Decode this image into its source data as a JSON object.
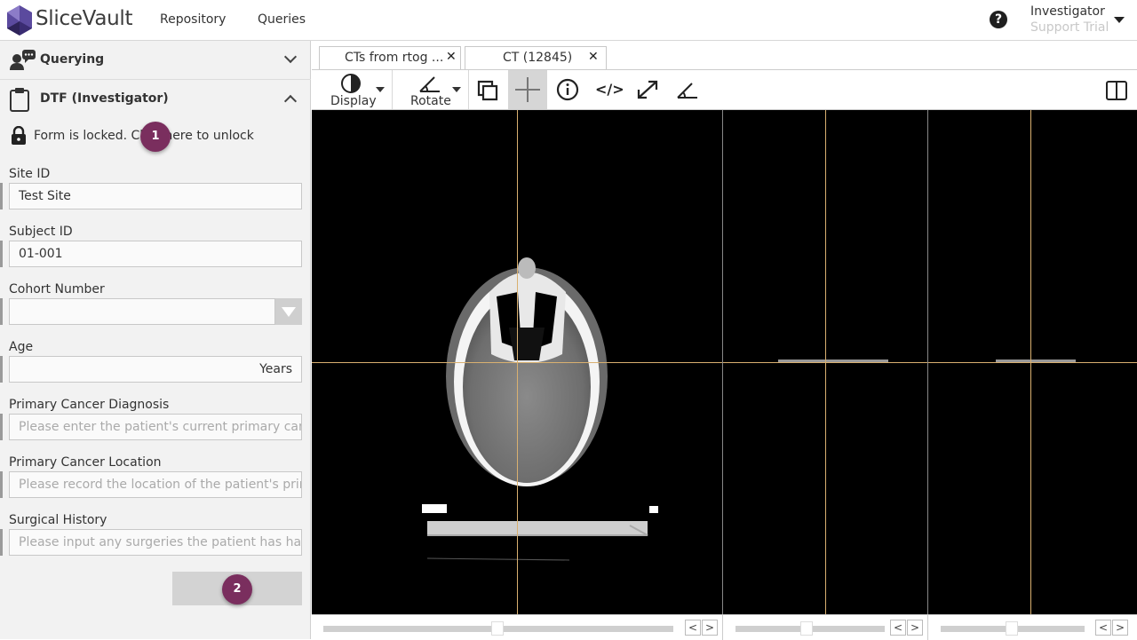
{
  "app": {
    "brand": "SliceVault",
    "brand_color": "#4a3a8c"
  },
  "nav": {
    "items": [
      "Repository",
      "Queries"
    ]
  },
  "user": {
    "name": "Investigator",
    "role": "Support Trial"
  },
  "sidebar": {
    "querying_title": "Querying",
    "form_title": "DTF (Investigator)",
    "lock_message": "Form is locked. Click here to unlock",
    "fields": {
      "site_id": {
        "label": "Site ID",
        "value": "Test Site"
      },
      "subject_id": {
        "label": "Subject ID",
        "value": "01-001"
      },
      "cohort": {
        "label": "Cohort Number",
        "value": ""
      },
      "age": {
        "label": "Age",
        "unit": "Years"
      },
      "diagnosis": {
        "label": "Primary Cancer Diagnosis",
        "placeholder": "Please enter the patient's current primary cancer"
      },
      "location": {
        "label": "Primary Cancer Location",
        "placeholder": "Please record the location of the patient's primar"
      },
      "surgical": {
        "label": "Surgical History",
        "placeholder": "Please input any surgeries the patient has had pr"
      }
    },
    "badges": [
      "1",
      "2"
    ],
    "badge_color": "#7a2e5e"
  },
  "tabs": [
    {
      "label": "CTs from rtog ..."
    },
    {
      "label": "CT (12845)"
    }
  ],
  "toolbar": {
    "display_label": "Display",
    "rotate_label": "Rotate",
    "code_label": "</>"
  },
  "viewer": {
    "crosshair_color": "#d9b070",
    "nav_prev": "<",
    "nav_next": ">"
  }
}
